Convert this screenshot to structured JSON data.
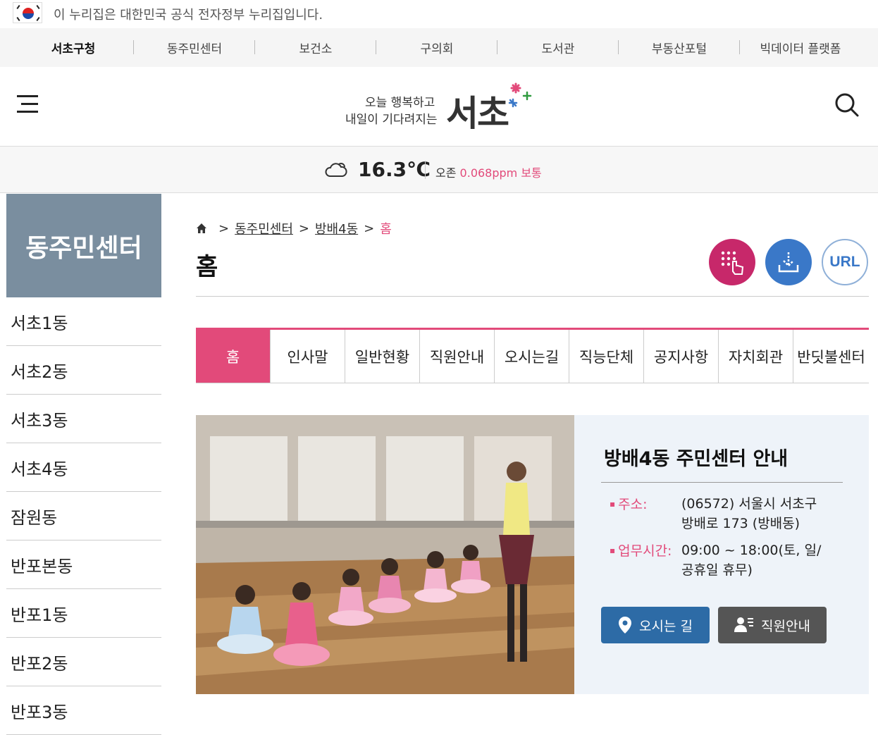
{
  "gov_notice": "이 누리집은 대한민국 공식 전자정부 누리집입니다.",
  "site_nav": [
    "서초구청",
    "동주민센터",
    "보건소",
    "구의회",
    "도서관",
    "부동산포털",
    "빅데이터 플랫폼"
  ],
  "logo": {
    "tagline1": "오늘 행복하고",
    "tagline2": "내일이 기다려지는",
    "name": "서초"
  },
  "weather": {
    "temperature": "16.3℃",
    "ozone_label": "오존",
    "ozone_value": "0.068ppm 보통"
  },
  "lnb": {
    "title": "동주민센터",
    "items": [
      "서초1동",
      "서초2동",
      "서초3동",
      "서초4동",
      "잠원동",
      "반포본동",
      "반포1동",
      "반포2동",
      "반포3동"
    ]
  },
  "breadcrumb": {
    "items": [
      "동주민센터",
      "방배4동"
    ],
    "current": "홈",
    "separator": ">"
  },
  "page_title": "홈",
  "tools": {
    "url_label": "URL"
  },
  "tabs": [
    "홈",
    "인사말",
    "일반현황",
    "직원안내",
    "오시는길",
    "직능단체",
    "공지사항",
    "자치회관",
    "반딧불센터"
  ],
  "info": {
    "heading": "방배4동 주민센터 안내",
    "address_label": "주소:",
    "address_value": "(06572) 서울시 서초구 방배로 173 (방배동)",
    "hours_label": "업무시간:",
    "hours_value": "09:00 ~ 18:00(토, 일/공휴일 휴무)",
    "directions_button": "오시는 길",
    "staff_button": "직원안내"
  },
  "colors": {
    "accent": "#e24a7a",
    "lnb_title_bg": "#7a8e9f",
    "directions_btn": "#2d6ba6",
    "staff_btn": "#555555"
  }
}
